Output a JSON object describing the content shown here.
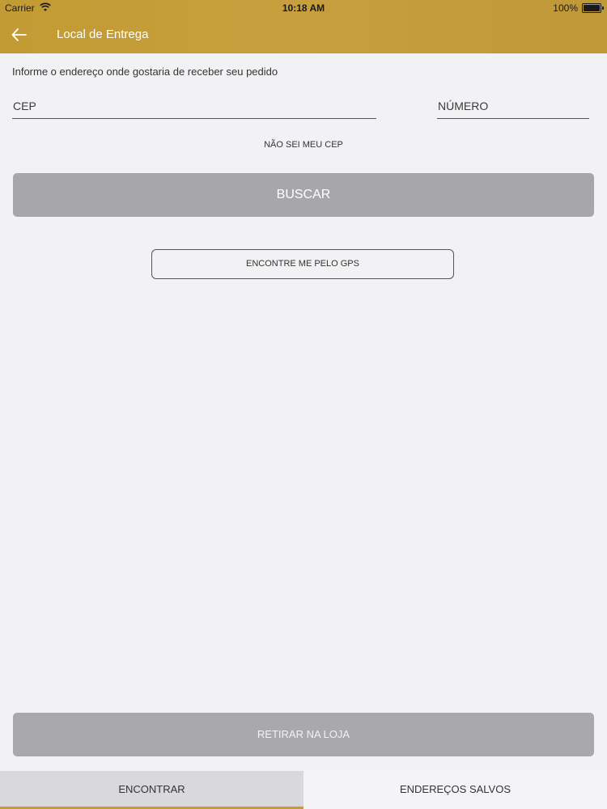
{
  "status_bar": {
    "carrier": "Carrier",
    "time": "10:18 AM",
    "battery": "100%"
  },
  "header": {
    "title": "Local de Entrega",
    "background_color": "#c39b34",
    "back_icon": "arrow-left-icon"
  },
  "form": {
    "instruction": "Informe o endereço onde gostaria de receber seu pedido",
    "cep_placeholder": "CEP",
    "cep_value": "",
    "numero_placeholder": "NÚMERO",
    "numero_value": "",
    "nao_sei_cep": "NÃO SEI MEU CEP",
    "buscar_label": "BUSCAR",
    "gps_label": "ENCONTRE ME PELO GPS"
  },
  "footer": {
    "retirar_label": "RETIRAR NA LOJA"
  },
  "tabs": [
    {
      "label": "ENCONTRAR",
      "active": true
    },
    {
      "label": "ENDEREÇOS SALVOS",
      "active": false
    }
  ],
  "colors": {
    "accent": "#c39b34",
    "button_disabled": "#a7a6aa",
    "background": "#f2f2f4"
  }
}
